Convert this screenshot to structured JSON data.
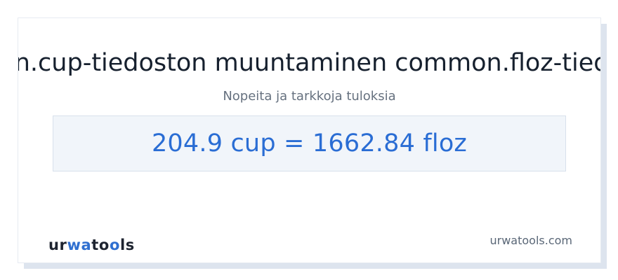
{
  "header": {
    "title": "common.cup-tiedoston muuntaminen common.floz-tiedostoksi",
    "subtitle": "Nopeita ja tarkkoja tuloksia"
  },
  "result": {
    "text": "204.9 cup = 1662.84 floz"
  },
  "footer": {
    "logo_text": "urwatools",
    "site_link": "urwatools.com"
  },
  "colors": {
    "accent": "#2a6dd4",
    "title": "#16202e",
    "subtitle": "#66717f",
    "result_bg": "#f1f5fa"
  }
}
